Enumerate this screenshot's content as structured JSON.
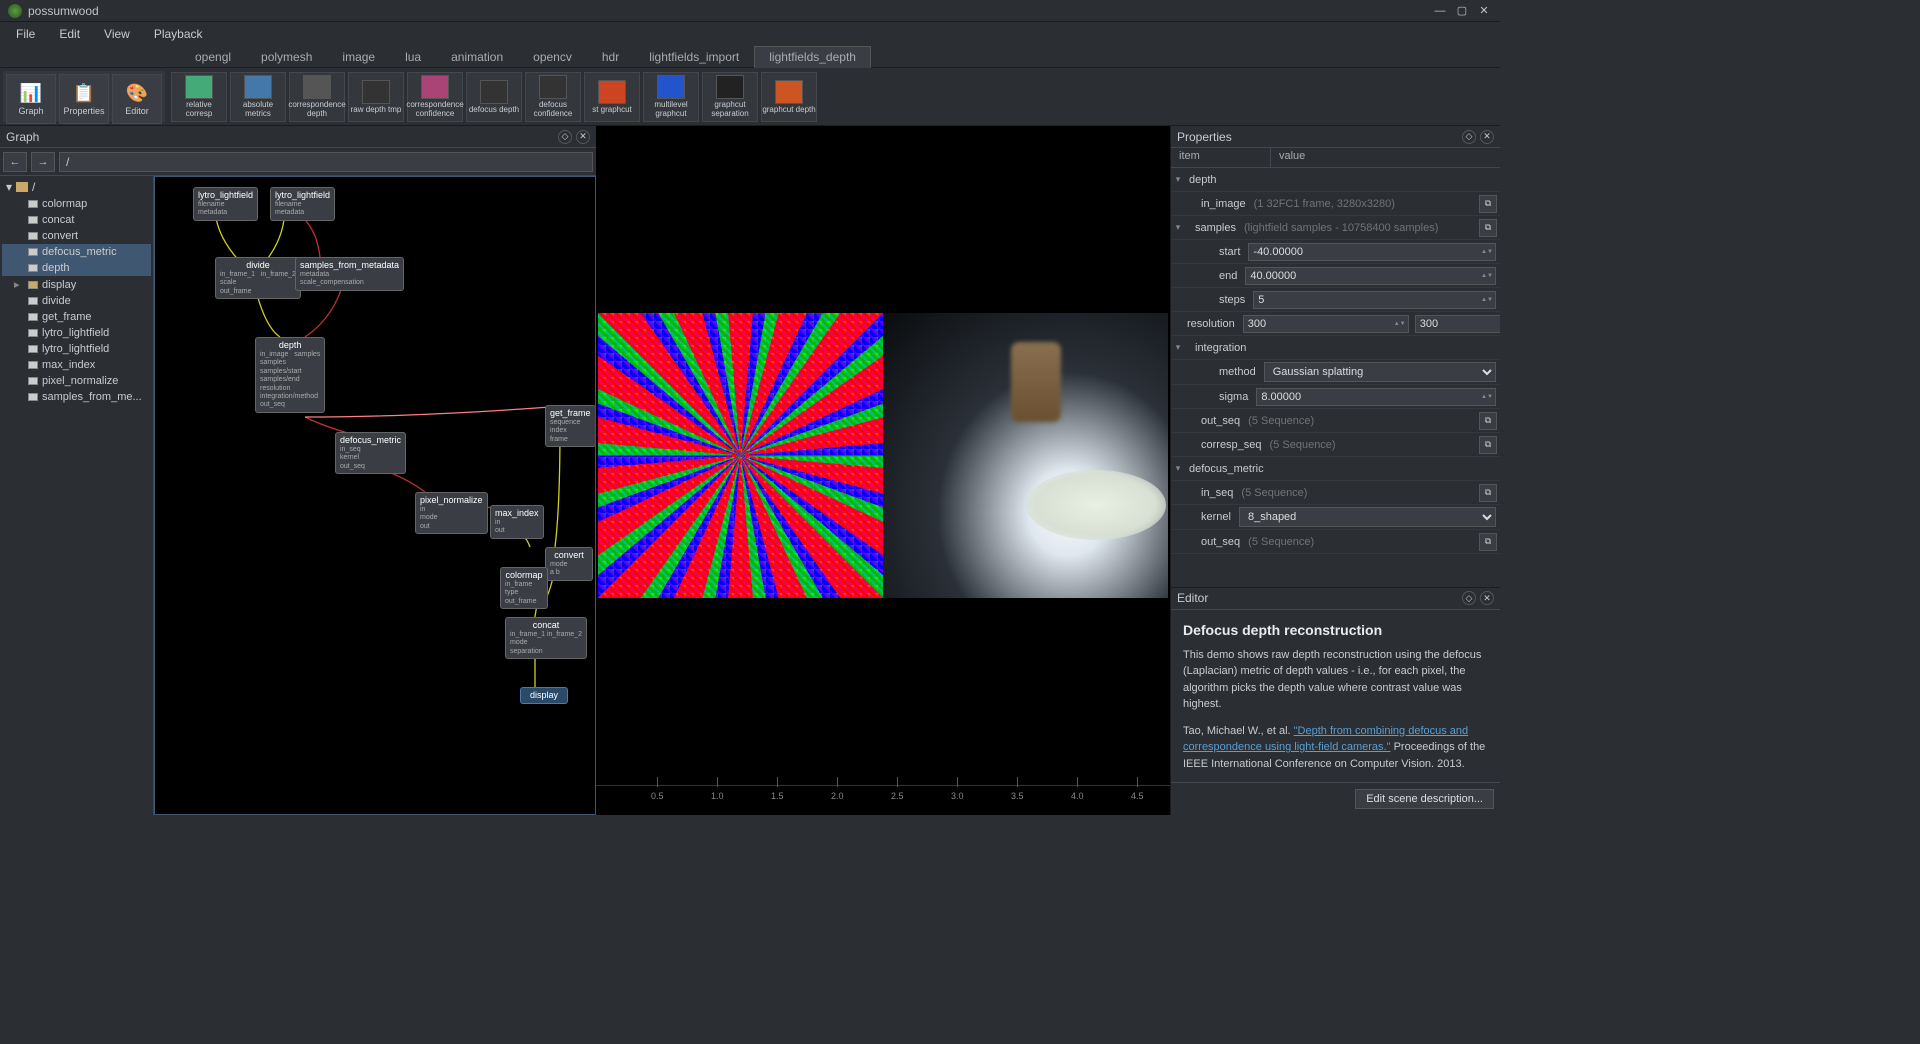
{
  "window": {
    "title": "possumwood"
  },
  "menu": [
    "File",
    "Edit",
    "View",
    "Playback"
  ],
  "tabs": [
    "opengl",
    "polymesh",
    "image",
    "lua",
    "animation",
    "opencv",
    "hdr",
    "lightfields_import",
    "lightfields_depth"
  ],
  "active_tab": "lightfields_depth",
  "modes": [
    {
      "label": "Graph",
      "icon": "⬡"
    },
    {
      "label": "Properties",
      "icon": "☰"
    },
    {
      "label": "Editor",
      "icon": "🎨"
    }
  ],
  "tools": [
    {
      "label": "relative corresp"
    },
    {
      "label": "absolute metrics"
    },
    {
      "label": "correspondence depth"
    },
    {
      "label": "raw depth tmp"
    },
    {
      "label": "correspondence confidence"
    },
    {
      "label": "defocus depth"
    },
    {
      "label": "defocus confidence"
    },
    {
      "label": "st graphcut"
    },
    {
      "label": "multilevel graphcut"
    },
    {
      "label": "graphcut separation"
    },
    {
      "label": "graphcut depth"
    }
  ],
  "graph": {
    "title": "Graph",
    "breadcrumb": "/",
    "root": "/",
    "tree": [
      {
        "name": "colormap"
      },
      {
        "name": "concat"
      },
      {
        "name": "convert"
      },
      {
        "name": "defocus_metric",
        "sel": true
      },
      {
        "name": "depth",
        "sel": true
      },
      {
        "name": "display",
        "folder": true
      },
      {
        "name": "divide"
      },
      {
        "name": "get_frame"
      },
      {
        "name": "lytro_lightfield"
      },
      {
        "name": "lytro_lightfield"
      },
      {
        "name": "max_index"
      },
      {
        "name": "pixel_normalize"
      },
      {
        "name": "samples_from_me..."
      }
    ],
    "nodes": {
      "lytro1": "lytro_lightfield",
      "lytro2": "lytro_lightfield",
      "divide": "divide",
      "samples": "samples_from_metadata",
      "depth": "depth",
      "defocus": "defocus_metric",
      "getframe": "get_frame",
      "pixnorm": "pixel_normalize",
      "maxidx": "max_index",
      "convert": "convert",
      "colormap": "colormap",
      "concat": "concat",
      "display": "display"
    }
  },
  "timeline": [
    "0.5",
    "1.0",
    "1.5",
    "2.0",
    "2.5",
    "3.0",
    "3.5",
    "4.0",
    "4.5"
  ],
  "props": {
    "title": "Properties",
    "cols": {
      "item": "item",
      "value": "value"
    },
    "depth": {
      "label": "depth",
      "in_image": {
        "label": "in_image",
        "info": "(1 32FC1 frame, 3280x3280)"
      },
      "samples": {
        "label": "samples",
        "info": "(lightfield samples - 10758400 samples)",
        "start": {
          "label": "start",
          "value": "-40.00000"
        },
        "end": {
          "label": "end",
          "value": "40.00000"
        },
        "steps": {
          "label": "steps",
          "value": "5"
        }
      },
      "resolution": {
        "label": "resolution",
        "x": "300",
        "y": "300"
      },
      "integration": {
        "label": "integration",
        "method": {
          "label": "method",
          "value": "Gaussian splatting"
        },
        "sigma": {
          "label": "sigma",
          "value": "8.00000"
        }
      },
      "out_seq": {
        "label": "out_seq",
        "info": "(5 Sequence)"
      },
      "corresp_seq": {
        "label": "corresp_seq",
        "info": "(5 Sequence)"
      }
    },
    "defocus_metric": {
      "label": "defocus_metric",
      "in_seq": {
        "label": "in_seq",
        "info": "(5 Sequence)"
      },
      "kernel": {
        "label": "kernel",
        "value": "8_shaped"
      },
      "out_seq": {
        "label": "out_seq",
        "info": "(5 Sequence)"
      }
    }
  },
  "editor": {
    "title": "Editor",
    "heading": "Defocus depth reconstruction",
    "body1": "This demo shows raw depth reconstruction using the defocus (Laplacian) metric of depth values - i.e., for each pixel, the algorithm picks the depth value where contrast value was highest.",
    "cite_pre": "Tao, Michael W., et al. ",
    "cite_link": "\"Depth from combining defocus and correspondence using light-field cameras.\"",
    "cite_post": " Proceedings of the IEEE International Conference on Computer Vision. 2013.",
    "btn": "Edit scene description..."
  }
}
